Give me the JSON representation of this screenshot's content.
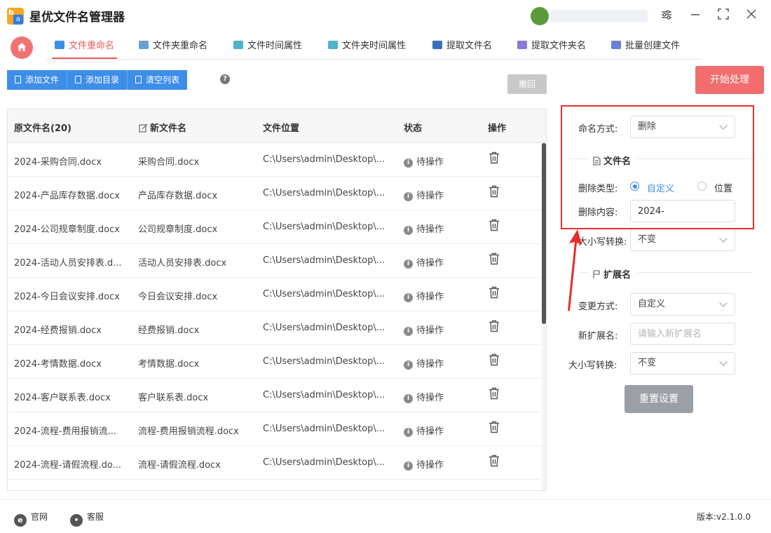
{
  "app": {
    "title": "星优文件名管理器",
    "logo_letters": [
      "b",
      "a"
    ]
  },
  "tabs": [
    {
      "label": "文件重命名",
      "active": true,
      "icon": "rename-icon",
      "color": "#3d8ee8"
    },
    {
      "label": "文件夹重命名",
      "active": false,
      "icon": "folder-rename-icon",
      "color": "#6b9fd6"
    },
    {
      "label": "文件时间属性",
      "active": false,
      "icon": "file-time-icon",
      "color": "#4fb3c9"
    },
    {
      "label": "文件夹时间属性",
      "active": false,
      "icon": "folder-time-icon",
      "color": "#4fb3c9"
    },
    {
      "label": "提取文件名",
      "active": false,
      "icon": "extract-filename-icon",
      "color": "#3d6fb8"
    },
    {
      "label": "提取文件夹名",
      "active": false,
      "icon": "extract-foldername-icon",
      "color": "#8a7bd6"
    },
    {
      "label": "批量创建文件",
      "active": false,
      "icon": "batch-create-icon",
      "color": "#6b7fd6"
    }
  ],
  "toolbar": {
    "add_file": "添加文件",
    "add_dir": "添加目录",
    "clear_list": "清空列表",
    "help": "?",
    "undo": "撤回",
    "start": "开始处理"
  },
  "table": {
    "headers": {
      "orig": "原文件名(20)",
      "new": "新文件名",
      "path": "文件位置",
      "status": "状态",
      "op": "操作"
    },
    "rows": [
      {
        "orig": "2024-采购合同.docx",
        "new": "采购合同.docx",
        "path": "C:\\Users\\admin\\Desktop\\...",
        "status": "待操作"
      },
      {
        "orig": "2024-产品库存数据.docx",
        "new": "产品库存数据.docx",
        "path": "C:\\Users\\admin\\Desktop\\...",
        "status": "待操作"
      },
      {
        "orig": "2024-公司规章制度.docx",
        "new": "公司规章制度.docx",
        "path": "C:\\Users\\admin\\Desktop\\...",
        "status": "待操作"
      },
      {
        "orig": "2024-活动人员安排表.d...",
        "new": "活动人员安排表.docx",
        "path": "C:\\Users\\admin\\Desktop\\...",
        "status": "待操作"
      },
      {
        "orig": "2024-今日会议安排.docx",
        "new": "今日会议安排.docx",
        "path": "C:\\Users\\admin\\Desktop\\...",
        "status": "待操作"
      },
      {
        "orig": "2024-经费报销.docx",
        "new": "经费报销.docx",
        "path": "C:\\Users\\admin\\Desktop\\...",
        "status": "待操作"
      },
      {
        "orig": "2024-考情数据.docx",
        "new": "考情数据.docx",
        "path": "C:\\Users\\admin\\Desktop\\...",
        "status": "待操作"
      },
      {
        "orig": "2024-客户联系表.docx",
        "new": "客户联系表.docx",
        "path": "C:\\Users\\admin\\Desktop\\...",
        "status": "待操作"
      },
      {
        "orig": "2024-流程-费用报销流...",
        "new": "流程-费用报销流程.docx",
        "path": "C:\\Users\\admin\\Desktop\\...",
        "status": "待操作"
      },
      {
        "orig": "2024-流程-请假流程.do...",
        "new": "流程-请假流程.docx",
        "path": "C:\\Users\\admin\\Desktop\\...",
        "status": "待操作"
      }
    ]
  },
  "settings": {
    "naming_method_label": "命名方式:",
    "naming_method_value": "删除",
    "filename_section": "文件名",
    "delete_type_label": "删除类型:",
    "delete_type_options": [
      "自定义",
      "位置"
    ],
    "delete_type_selected": "自定义",
    "delete_content_label": "删除内容:",
    "delete_content_value": "2024-",
    "case_label": "大小写转换:",
    "case_value": "不变",
    "ext_section": "扩展名",
    "change_method_label": "变更方式:",
    "change_method_value": "自定义",
    "new_ext_label": "新扩展名:",
    "new_ext_placeholder": "请输入新扩展名",
    "ext_case_label": "大小写转换:",
    "ext_case_value": "不变",
    "reset": "重置设置"
  },
  "footer": {
    "website": "官网",
    "support": "客服",
    "version_label": "版本:",
    "version": "v2.1.0.0"
  },
  "colors": {
    "accent_red": "#f05a5a",
    "primary_blue": "#3d8ee8",
    "highlight_red": "#e82c2c"
  }
}
